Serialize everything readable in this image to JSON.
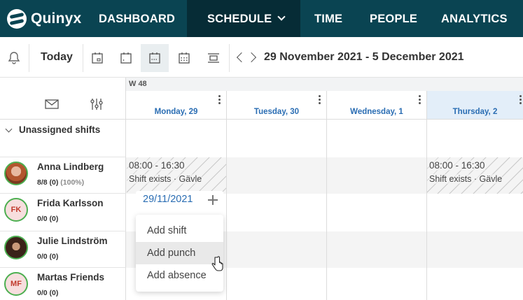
{
  "app": {
    "logo_text": "Quinyx"
  },
  "nav": {
    "dashboard": "DASHBOARD",
    "schedule": "SCHEDULE",
    "time": "TIME",
    "people": "PEOPLE",
    "analytics": "ANALYTICS"
  },
  "toolbar": {
    "today": "Today",
    "date_range": "29 November 2021 - 5 December 2021"
  },
  "grid": {
    "week": "W 48",
    "days": [
      "Monday, 29",
      "Tuesday, 30",
      "Wednesday, 1",
      "Thursday, 2"
    ]
  },
  "unassigned": {
    "label": "Unassigned shifts"
  },
  "people": [
    {
      "name": "Anna Lindberg",
      "stats": "8/8 (0)",
      "pct": "(100%)",
      "initials": ""
    },
    {
      "name": "Frida Karlsson",
      "stats": "0/0 (0)",
      "pct": "",
      "initials": "FK"
    },
    {
      "name": "Julie Lindström",
      "stats": "0/0 (0)",
      "pct": "",
      "initials": ""
    },
    {
      "name": "Martas Friends",
      "stats": "0/0 (0)",
      "pct": "",
      "initials": "MF"
    }
  ],
  "shifts": [
    {
      "time": "08:00 - 16:30",
      "detail": "Shift exists · Gävle"
    },
    {
      "time": "08:00 - 16:30",
      "detail": "Shift exists · Gävle"
    }
  ],
  "context": {
    "date": "29/11/2021",
    "menu": [
      "Add shift",
      "Add punch",
      "Add absence"
    ]
  },
  "colors": {
    "nav_bg": "#0a4452",
    "nav_active": "#062c36",
    "day_label": "#2a6db3",
    "today_bg": "#e3eef9",
    "avatar_ring": "#4caf50"
  }
}
